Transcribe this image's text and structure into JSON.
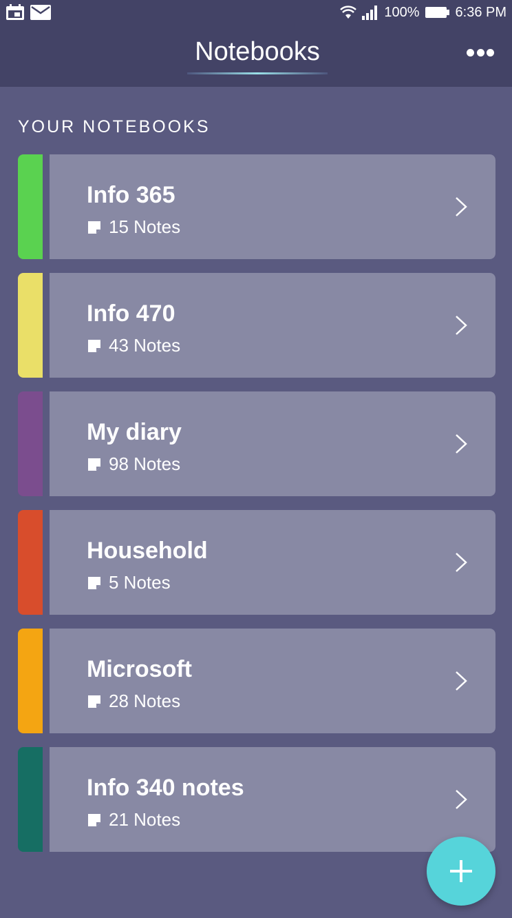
{
  "status_bar": {
    "battery": "100%",
    "time": "6:36 PM"
  },
  "header": {
    "title": "Notebooks"
  },
  "section": {
    "title": "YOUR NOTEBOOKS"
  },
  "notebooks": [
    {
      "name": "Info 365",
      "count": "15 Notes",
      "color": "#5ad250"
    },
    {
      "name": "Info 470",
      "count": "43 Notes",
      "color": "#eadf68"
    },
    {
      "name": "My diary",
      "count": "98 Notes",
      "color": "#7b4d8e"
    },
    {
      "name": "Household",
      "count": "5 Notes",
      "color": "#d84d2c"
    },
    {
      "name": "Microsoft",
      "count": "28 Notes",
      "color": "#f4a512"
    },
    {
      "name": "Info 340 notes",
      "count": "21 Notes",
      "color": "#166e63"
    }
  ],
  "colors": {
    "background": "#5a5a80",
    "header": "#434366",
    "card": "#8889a4",
    "fab": "#56d4da"
  }
}
